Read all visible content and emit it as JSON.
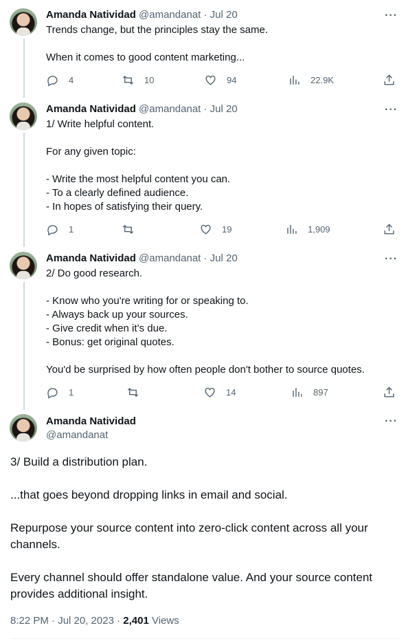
{
  "author": {
    "name": "Amanda Natividad",
    "handle": "@amandanat",
    "date": "· Jul 20"
  },
  "more_label": "···",
  "tweets": [
    {
      "lines": [
        "Trends change, but the principles stay the same.",
        "",
        "When it comes to good content marketing..."
      ],
      "replies": "4",
      "retweets": "10",
      "likes": "94",
      "views": "22.9K"
    },
    {
      "lines": [
        "1/ Write helpful content.",
        "",
        "For any given topic:",
        "",
        "- Write the most helpful content you can.",
        "- To a clearly defined audience.",
        "- In hopes of satisfying their query."
      ],
      "replies": "1",
      "retweets": "",
      "likes": "19",
      "views": "1,909"
    },
    {
      "lines": [
        "2/ Do good research.",
        "",
        "- Know who you're writing for or speaking to.",
        "- Always back up your sources.",
        "- Give credit when it’s due.",
        "- Bonus: get original quotes.",
        "",
        "You'd be surprised by how often people don't bother to source quotes."
      ],
      "replies": "1",
      "retweets": "",
      "likes": "14",
      "views": "897"
    }
  ],
  "main_tweet": {
    "lines": [
      "3/ Build a distribution plan.",
      "",
      "...that goes beyond dropping links in email and social.",
      "",
      "Repurpose your source content into zero-click content across all your channels.",
      "",
      "Every channel should offer standalone value. And your source content provides additional insight."
    ],
    "time": "8:22 PM · Jul 20, 2023 · ",
    "views_count": "2,401",
    "views_label": " Views"
  }
}
